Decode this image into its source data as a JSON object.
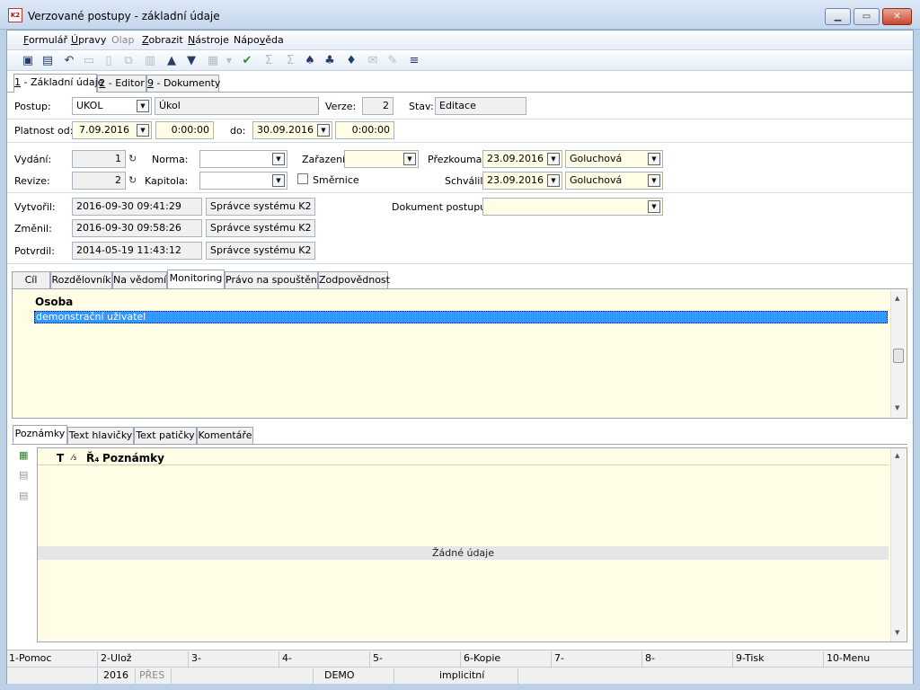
{
  "window": {
    "title": "Verzované postupy - základní údaje",
    "app_icon": "K2"
  },
  "menu": [
    {
      "pre": "",
      "u": "F",
      "post": "ormulář"
    },
    {
      "pre": "",
      "u": "Ú",
      "post": "pravy"
    },
    {
      "pre": "Olap",
      "u": "",
      "post": ""
    },
    {
      "pre": "",
      "u": "Z",
      "post": "obrazit"
    },
    {
      "pre": "",
      "u": "N",
      "post": "ástroje"
    },
    {
      "pre": "Nápo",
      "u": "v",
      "post": "ěda"
    }
  ],
  "main_tabs": [
    {
      "num": "1",
      "label": " - Základní údaje"
    },
    {
      "num": "2",
      "label": " - Editor"
    },
    {
      "num": "9",
      "label": " - Dokumenty"
    }
  ],
  "form": {
    "postup_label": "Postup:",
    "postup_value": "UKOL",
    "postup_name": "Úkol",
    "verze_label": "Verze:",
    "verze_value": "2",
    "stav_label": "Stav:",
    "stav_value": "Editace",
    "platnost_label": "Platnost od:",
    "platnost_od_date": "7.09.2016",
    "platnost_od_time": "0:00:00",
    "do_label": "do:",
    "do_date": "30.09.2016",
    "do_time": "0:00:00",
    "vydani_label": "Vydání:",
    "vydani_value": "1",
    "revize_label": "Revize:",
    "revize_value": "2",
    "norma_label": "Norma:",
    "norma_value": "",
    "kapitola_label": "Kapitola:",
    "kapitola_value": "",
    "zarazeni_label": "Zařazení:",
    "zarazeni_value": "",
    "smernice_label": "Směrnice",
    "prezkoumal_label": "Přezkoumal:",
    "prezkoumal_date": "23.09.2016",
    "prezkoumal_person": "Goluchová",
    "schvalil_label": "Schválil:",
    "schvalil_date": "23.09.2016",
    "schvalil_person": "Goluchová",
    "vytvoril_label": "Vytvořil:",
    "vytvoril_time": "2016-09-30 09:41:29",
    "vytvoril_user": "Správce systému K2",
    "zmenil_label": "Změnil:",
    "zmenil_time": "2016-09-30 09:58:26",
    "zmenil_user": "Správce systému K2",
    "potvrdil_label": "Potvrdil:",
    "potvrdil_time": "2014-05-19 11:43:12",
    "potvrdil_user": "Správce systému K2",
    "dokument_label": "Dokument postupu:",
    "dokument_value": ""
  },
  "sub_tabs": [
    "Cíl",
    "Rozdělovník",
    "Na vědomí",
    "Monitoring",
    "Právo na spouštění",
    "Zodpovědnost"
  ],
  "monitoring_grid": {
    "column": "Osoba",
    "rows": [
      "demonstrační uživatel"
    ]
  },
  "notes_tabs": [
    "Poznámky",
    "Text hlavičky",
    "Text patičky",
    "Komentáře"
  ],
  "notes_grid": {
    "col_t": "T",
    "col_slash": "⁄₃",
    "col_r": "Ř₄",
    "column": "Poznámky",
    "empty_text": "Žádné údaje"
  },
  "fkeys": [
    "1-Pomoc",
    "2-Ulož",
    "3-",
    "4-",
    "5-",
    "6-Kopie",
    "7-",
    "8-",
    "9-Tisk",
    "10-Menu"
  ],
  "status": {
    "year": "2016",
    "pres": "PŘES",
    "db": "DEMO",
    "mode": "implicitní"
  }
}
